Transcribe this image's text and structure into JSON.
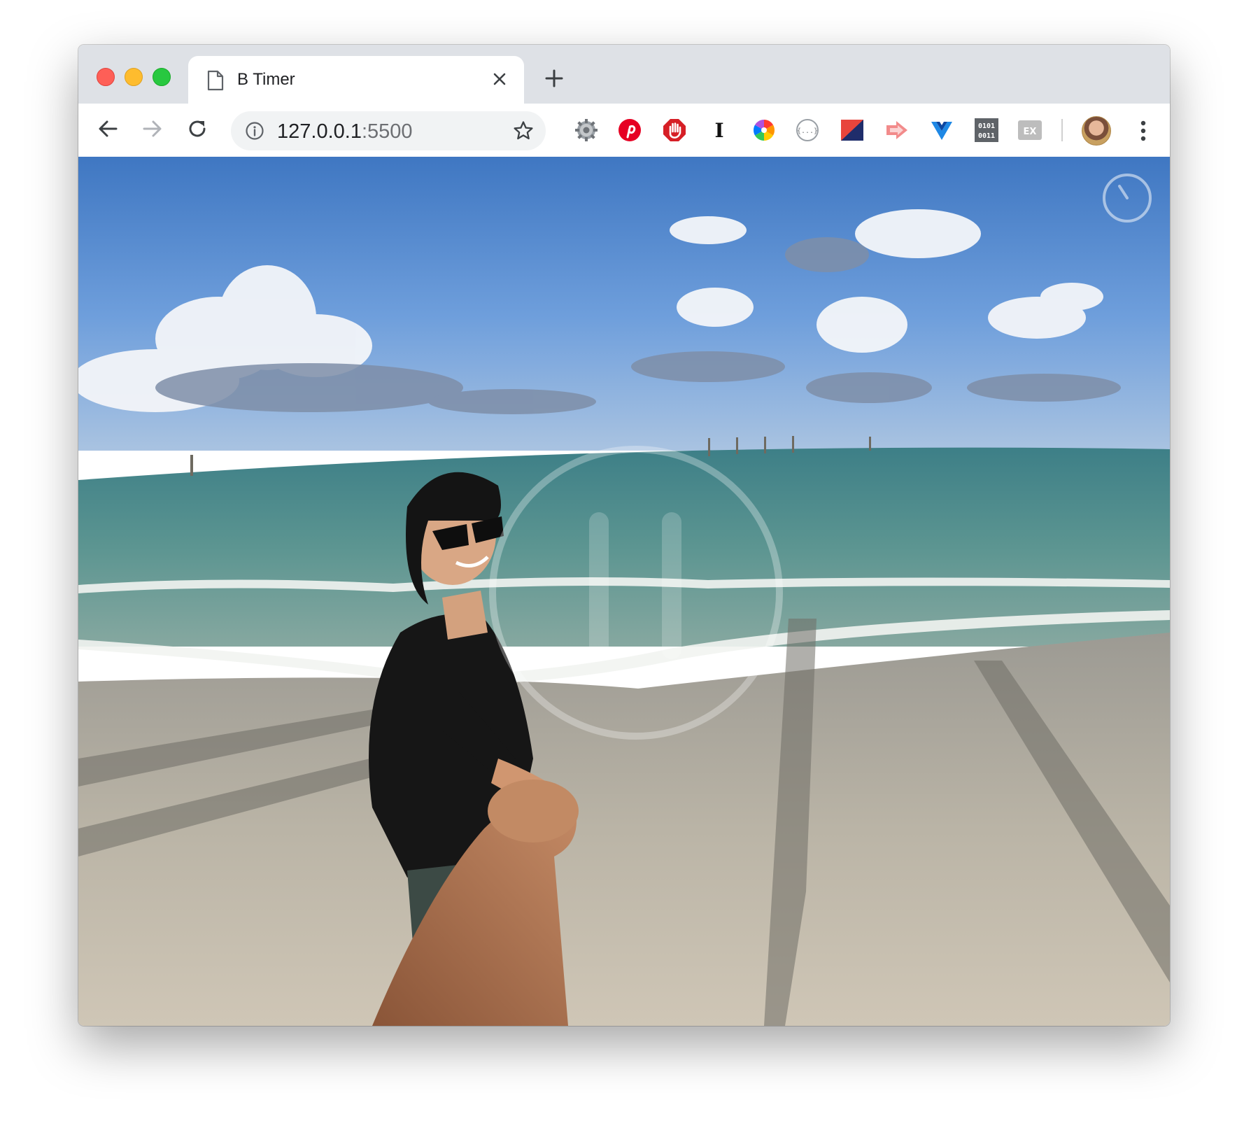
{
  "browser": {
    "tab": {
      "title": "B Timer",
      "icon": "document-icon"
    },
    "address_bar": {
      "host": "127.0.0.1",
      "port": ":5500",
      "info_icon": "info-icon",
      "bookmark_icon": "star-icon"
    },
    "nav": {
      "back_icon": "arrow-left-icon",
      "forward_icon": "arrow-right-icon",
      "reload_icon": "reload-icon"
    },
    "extensions": [
      {
        "name": "settings-gear-icon"
      },
      {
        "name": "pinterest-icon"
      },
      {
        "name": "adblock-hand-icon"
      },
      {
        "name": "text-cursor-icon",
        "glyph": "I"
      },
      {
        "name": "color-wheel-icon"
      },
      {
        "name": "json-viewer-icon",
        "glyph": "{...}"
      },
      {
        "name": "flag-split-icon"
      },
      {
        "name": "cast-arrow-icon"
      },
      {
        "name": "vue-devtools-icon"
      },
      {
        "name": "binary-icon",
        "glyph": [
          "0101",
          "0011"
        ]
      },
      {
        "name": "ex-icon",
        "glyph": "EX"
      }
    ],
    "profile": "avatar",
    "menu_icon": "kebab-menu-icon"
  },
  "page": {
    "background_photo": "beach-follow-me-photo",
    "timer_button_icon": "timer-icon",
    "overlay_icon": "pause-icon"
  },
  "colors": {
    "tabstrip": "#dee1e6",
    "omnibox": "#f1f3f4",
    "traffic_close": "#fe5f57",
    "traffic_min": "#febc2e",
    "traffic_max": "#28c840"
  }
}
